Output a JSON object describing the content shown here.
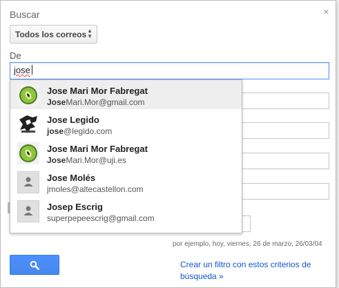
{
  "dialog": {
    "title": "Buscar",
    "close_glyph": "×",
    "scope": {
      "selected": "Todos los correos"
    },
    "from": {
      "label": "De",
      "value": "jose"
    },
    "date_hint": "por ejemplo, hoy, viernes, 26 de marzo, 26/03/04",
    "create_filter_label": "Crear un filtro con estos criterios de búsqueda »"
  },
  "suggestions": [
    {
      "name": "Jose Mari Mor Fabregat",
      "email_match": "Jose",
      "email_rest": "Mari.Mor@gmail.com",
      "avatar": "kiwi-avatar",
      "active": true
    },
    {
      "name": "Jose Legido",
      "email_match": "jose",
      "email_rest": "@legido.com",
      "avatar": "sketch-photo-avatar",
      "active": false
    },
    {
      "name": "Jose Mari Mor Fabregat",
      "email_match": "Jose",
      "email_rest": "Mari.Mor@uji.es",
      "avatar": "kiwi-avatar",
      "active": false
    },
    {
      "name": "Jose Molés",
      "email_match": "",
      "email_rest": "jmoles@altecastellon.com",
      "avatar": "default-person-avatar",
      "active": false
    },
    {
      "name": "Josep Escrig",
      "email_match": "",
      "email_rest": "superpepeescrig@gmail.com",
      "avatar": "default-person-avatar",
      "active": false
    }
  ],
  "colors": {
    "accent": "#4d90fe",
    "link": "#1155cc",
    "active_row": "#eeeeee",
    "kiwi_green": "#8cc63f"
  }
}
